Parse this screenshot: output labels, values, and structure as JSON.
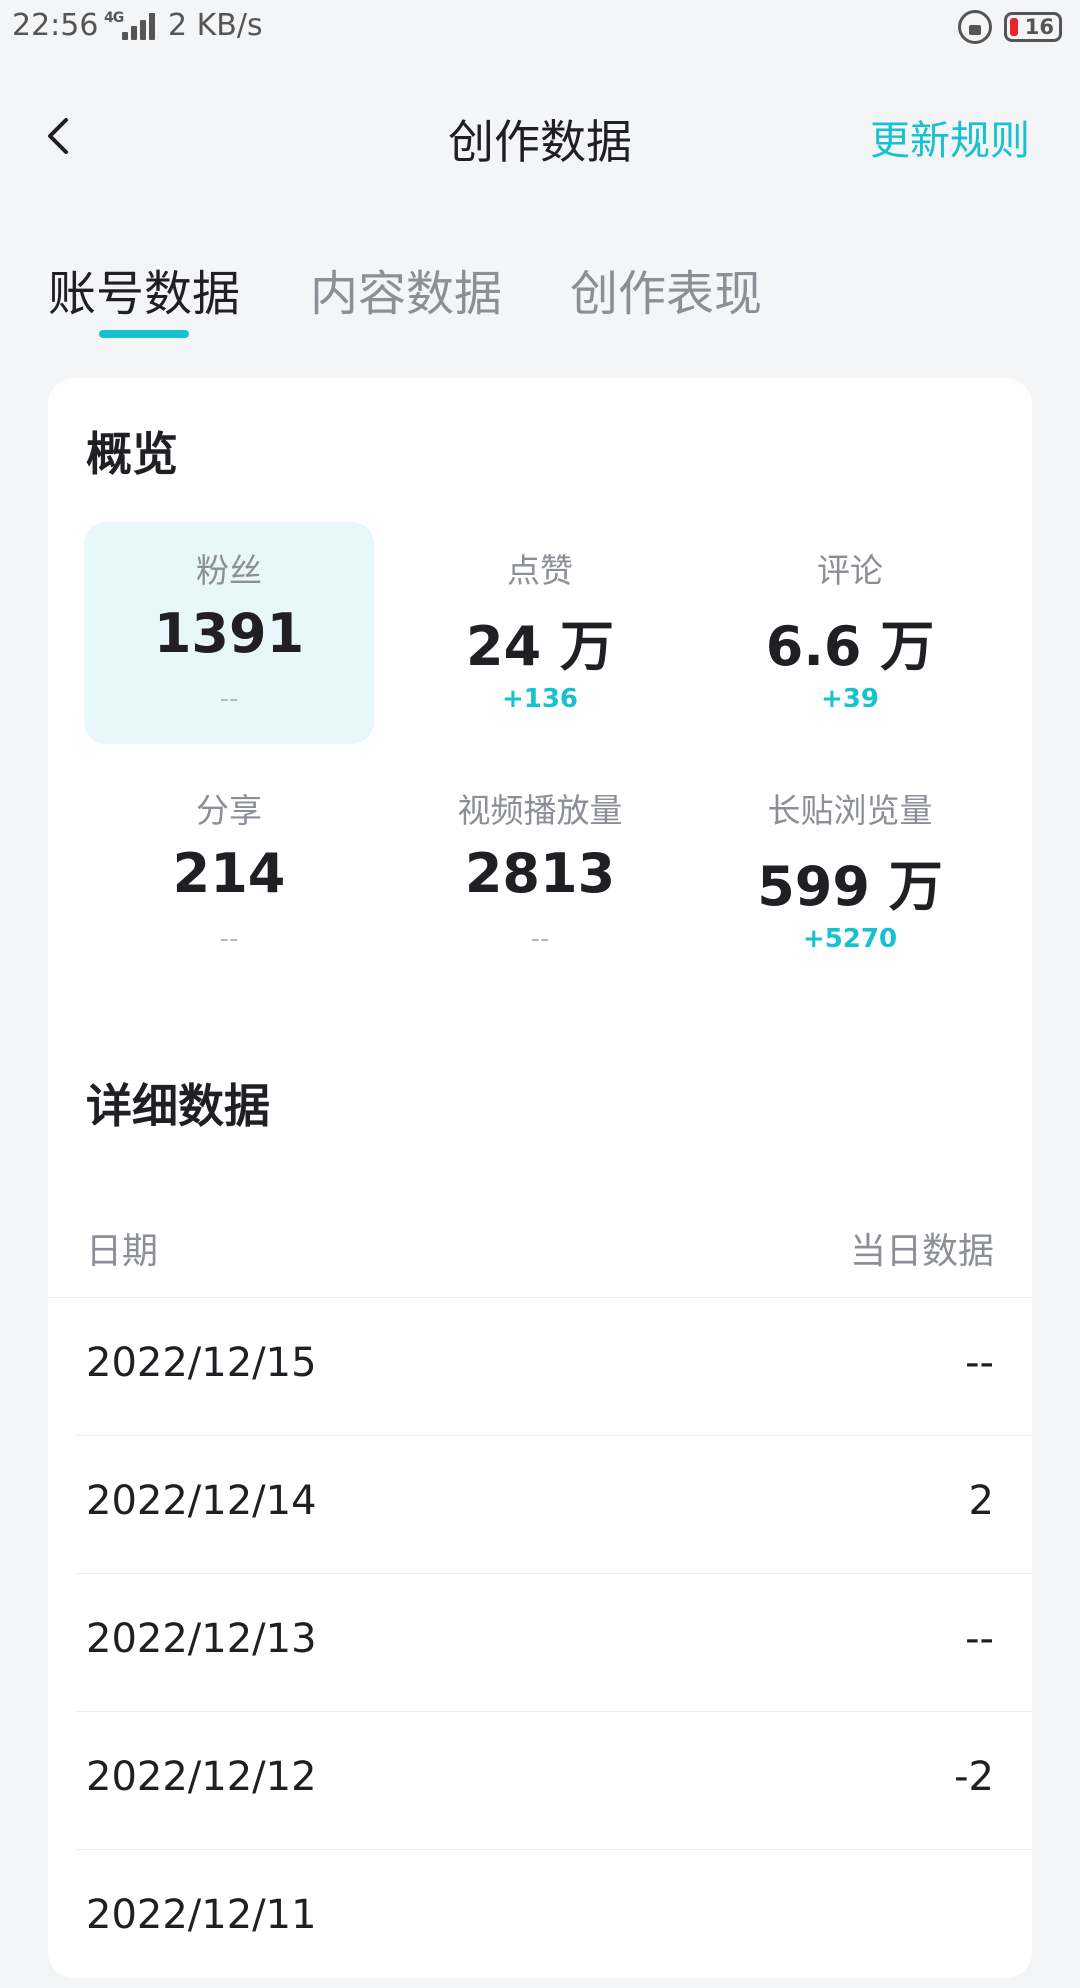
{
  "status_bar": {
    "time": "22:56",
    "network": "4G",
    "speed": "2 KB/s",
    "battery": "16"
  },
  "header": {
    "title": "创作数据",
    "rules_link": "更新规则"
  },
  "tabs": [
    {
      "label": "账号数据",
      "active": true
    },
    {
      "label": "内容数据",
      "active": false
    },
    {
      "label": "创作表现",
      "active": false
    }
  ],
  "overview": {
    "title": "概览",
    "metrics": [
      {
        "label": "粉丝",
        "value": "1391",
        "change": "--"
      },
      {
        "label": "点赞",
        "value": "24 万",
        "change": "+136"
      },
      {
        "label": "评论",
        "value": "6.6 万",
        "change": "+39"
      },
      {
        "label": "分享",
        "value": "214",
        "change": "--"
      },
      {
        "label": "视频播放量",
        "value": "2813",
        "change": "--"
      },
      {
        "label": "长贴浏览量",
        "value": "599 万",
        "change": "+5270"
      }
    ]
  },
  "details": {
    "title": "详细数据",
    "columns": {
      "date": "日期",
      "value": "当日数据"
    },
    "rows": [
      {
        "date": "2022/12/15",
        "value": "--"
      },
      {
        "date": "2022/12/14",
        "value": "2"
      },
      {
        "date": "2022/12/13",
        "value": "--"
      },
      {
        "date": "2022/12/12",
        "value": "-2"
      },
      {
        "date": "2022/12/11",
        "value": ""
      }
    ]
  },
  "colors": {
    "accent": "#16c2cf",
    "highlight_bg": "#e8f7f9",
    "background": "#f4f5f7"
  }
}
